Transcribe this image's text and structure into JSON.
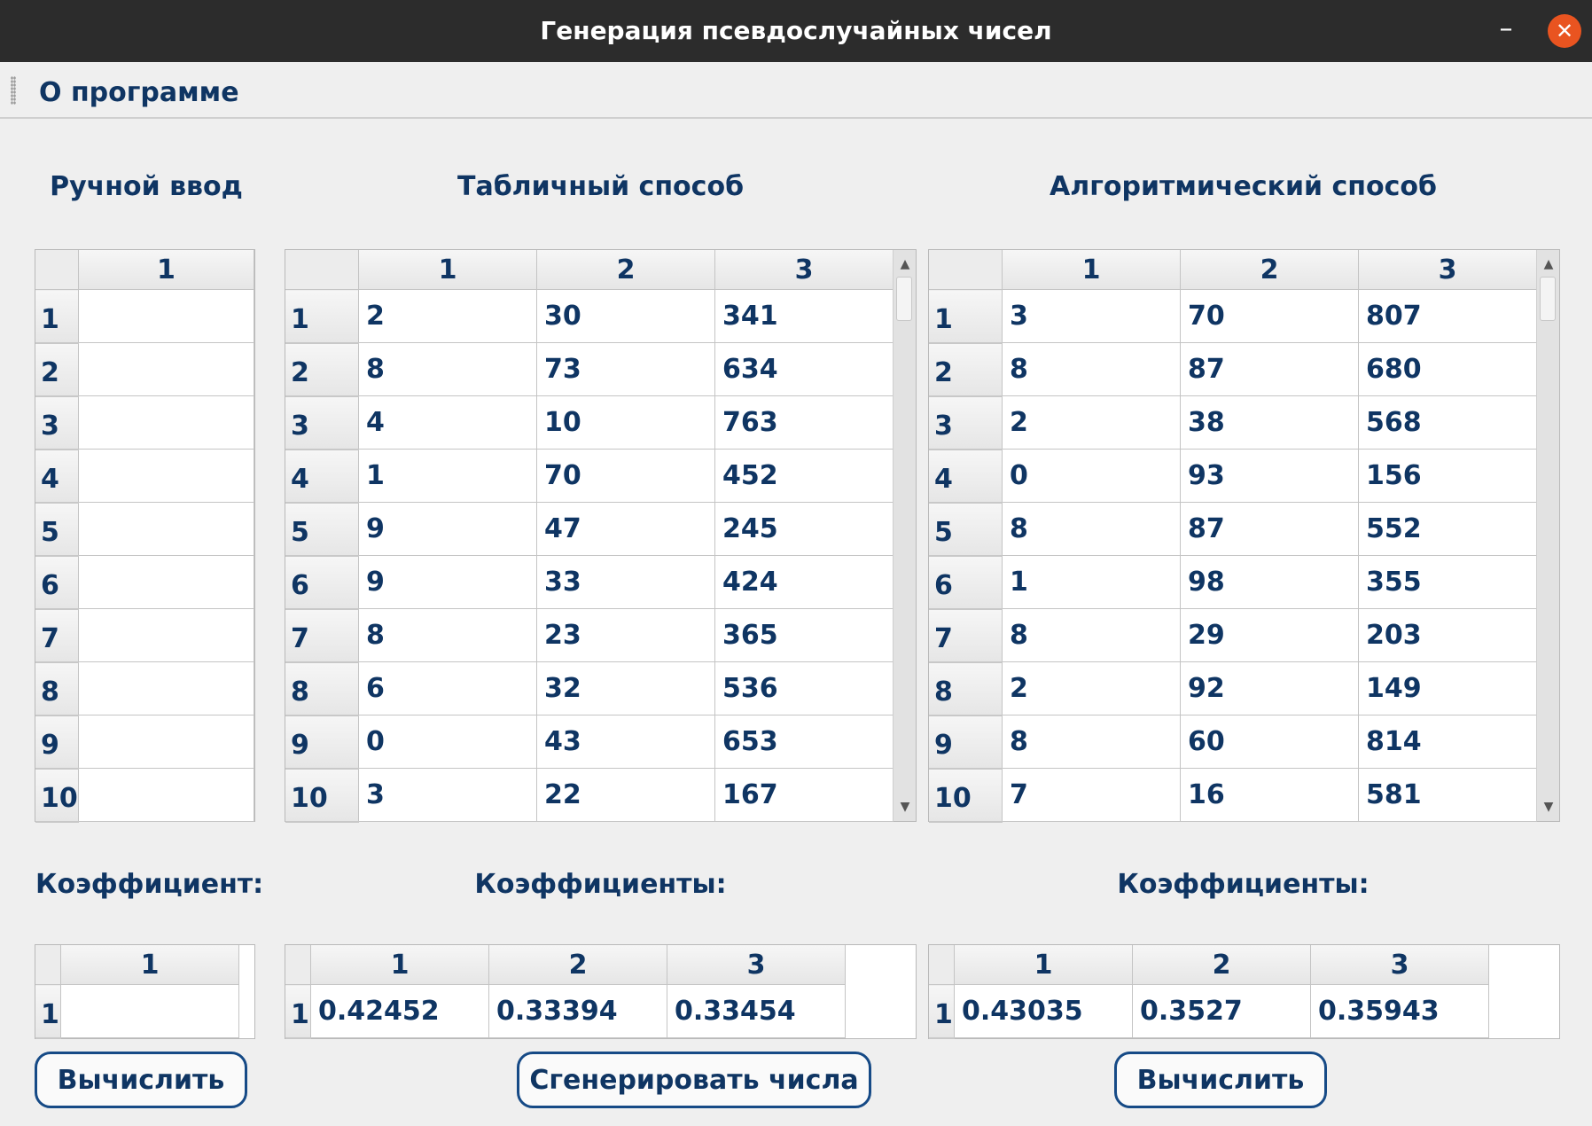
{
  "window": {
    "title": "Генерация псевдослучайных чисел",
    "minimize_label": "–",
    "close_label": "✕"
  },
  "menu": {
    "items": [
      "О программе"
    ]
  },
  "manual": {
    "title": "Ручной ввод",
    "columns": [
      "1"
    ],
    "rows": [
      [
        "1",
        ""
      ],
      [
        "2",
        ""
      ],
      [
        "3",
        ""
      ],
      [
        "4",
        ""
      ],
      [
        "5",
        ""
      ],
      [
        "6",
        ""
      ],
      [
        "7",
        ""
      ],
      [
        "8",
        ""
      ],
      [
        "9",
        ""
      ],
      [
        "10",
        ""
      ]
    ],
    "coef_label": "Коэффициент:",
    "coef_columns": [
      "1"
    ],
    "coef_rows": [
      [
        "1",
        ""
      ]
    ],
    "button": "Вычислить"
  },
  "tabular": {
    "title": "Табличный способ",
    "columns": [
      "1",
      "2",
      "3"
    ],
    "rows": [
      [
        "1",
        "2",
        "30",
        "341"
      ],
      [
        "2",
        "8",
        "73",
        "634"
      ],
      [
        "3",
        "4",
        "10",
        "763"
      ],
      [
        "4",
        "1",
        "70",
        "452"
      ],
      [
        "5",
        "9",
        "47",
        "245"
      ],
      [
        "6",
        "9",
        "33",
        "424"
      ],
      [
        "7",
        "8",
        "23",
        "365"
      ],
      [
        "8",
        "6",
        "32",
        "536"
      ],
      [
        "9",
        "0",
        "43",
        "653"
      ],
      [
        "10",
        "3",
        "22",
        "167"
      ]
    ],
    "coef_label": "Коэффициенты:",
    "coef_columns": [
      "1",
      "2",
      "3"
    ],
    "coef_rows": [
      [
        "1",
        "0.42452",
        "0.33394",
        "0.33454"
      ]
    ],
    "button": "Сгенерировать числа"
  },
  "algorithmic": {
    "title": "Алгоритмический способ",
    "columns": [
      "1",
      "2",
      "3"
    ],
    "rows": [
      [
        "1",
        "3",
        "70",
        "807"
      ],
      [
        "2",
        "8",
        "87",
        "680"
      ],
      [
        "3",
        "2",
        "38",
        "568"
      ],
      [
        "4",
        "0",
        "93",
        "156"
      ],
      [
        "5",
        "8",
        "87",
        "552"
      ],
      [
        "6",
        "1",
        "98",
        "355"
      ],
      [
        "7",
        "8",
        "29",
        "203"
      ],
      [
        "8",
        "2",
        "92",
        "149"
      ],
      [
        "9",
        "8",
        "60",
        "814"
      ],
      [
        "10",
        "7",
        "16",
        "581"
      ]
    ],
    "coef_label": "Коэффициенты:",
    "coef_columns": [
      "1",
      "2",
      "3"
    ],
    "coef_rows": [
      [
        "1",
        "0.43035",
        "0.3527",
        "0.35943"
      ]
    ],
    "button": "Вычислить"
  },
  "icons": {
    "scroll_up": "scroll-up-arrow-icon",
    "scroll_down": "scroll-down-arrow-icon",
    "grip": "toolbar-grip-icon"
  },
  "colors": {
    "text": "#0f3563",
    "titlebar": "#2c2c2c",
    "close": "#e95420",
    "button_border": "#164a86",
    "background": "#efefef"
  }
}
